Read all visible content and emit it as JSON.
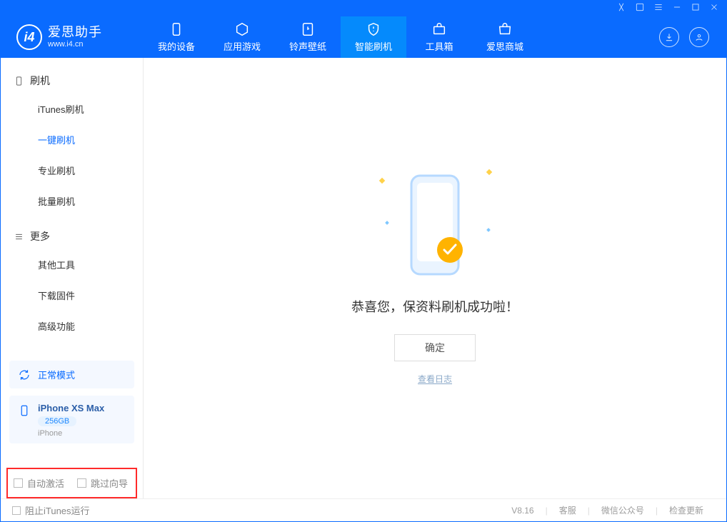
{
  "app": {
    "name": "爱思助手",
    "site": "www.i4.cn"
  },
  "nav": {
    "items": [
      {
        "label": "我的设备"
      },
      {
        "label": "应用游戏"
      },
      {
        "label": "铃声壁纸"
      },
      {
        "label": "智能刷机"
      },
      {
        "label": "工具箱"
      },
      {
        "label": "爱思商城"
      }
    ],
    "active_index": 3
  },
  "sidebar": {
    "section1": {
      "title": "刷机",
      "items": [
        "iTunes刷机",
        "一键刷机",
        "专业刷机",
        "批量刷机"
      ],
      "active_index": 1
    },
    "section2": {
      "title": "更多",
      "items": [
        "其他工具",
        "下载固件",
        "高级功能"
      ]
    }
  },
  "device": {
    "mode_label": "正常模式",
    "model": "iPhone XS Max",
    "capacity": "256GB",
    "kind": "iPhone"
  },
  "options": {
    "auto_activate_label": "自动激活",
    "skip_guide_label": "跳过向导",
    "auto_activate_checked": false,
    "skip_guide_checked": false
  },
  "main": {
    "success_title": "恭喜您，保资料刷机成功啦！",
    "confirm_label": "确定",
    "view_log_label": "查看日志"
  },
  "footer": {
    "block_itunes_label": "阻止iTunes运行",
    "version": "V8.16",
    "links": [
      "客服",
      "微信公众号",
      "检查更新"
    ]
  },
  "colors": {
    "primary": "#0a6bff",
    "active": "#058afc",
    "highlight_border": "#ff2a2a"
  }
}
